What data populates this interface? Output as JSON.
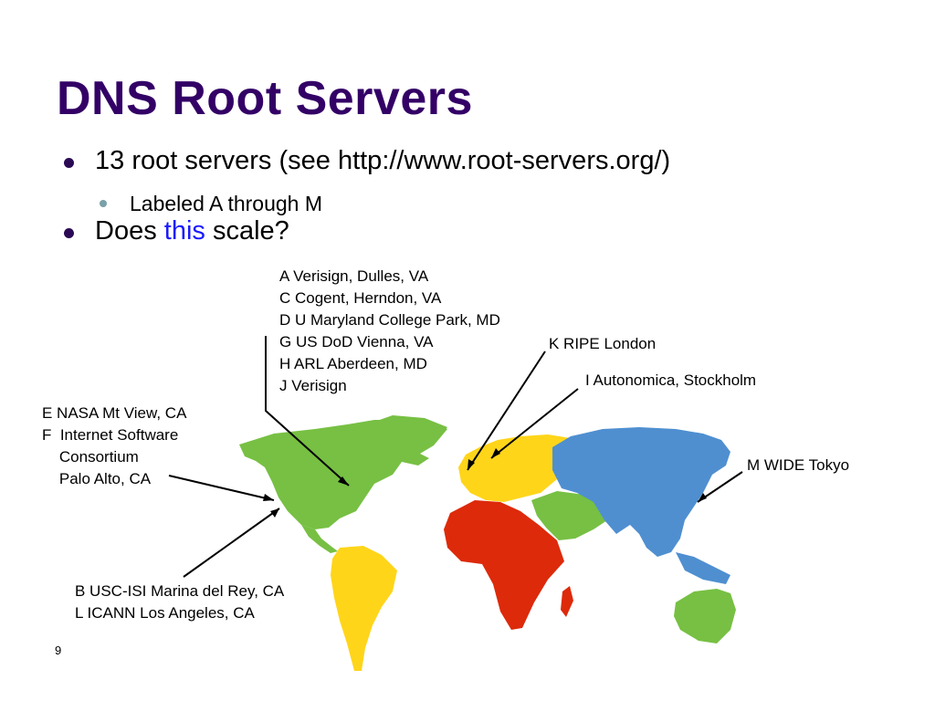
{
  "title": "DNS Root Servers",
  "bullets": {
    "b1": "13 root servers (see http://www.root-servers.org/)",
    "b1_sub": "Labeled A through M",
    "b2_pre": "Does",
    "b2_highlight": "this",
    "b2_post": "scale?"
  },
  "labels": {
    "us_east": [
      "A Verisign, Dulles, VA",
      "C Cogent, Herndon, VA",
      "D U Maryland College Park, MD",
      "G US DoD Vienna, VA",
      "H ARL Aberdeen, MD",
      "J Verisign"
    ],
    "ripe": "K RIPE London",
    "autonomica": "I Autonomica, Stockholm",
    "us_west": [
      "E NASA Mt View, CA",
      "F  Internet Software",
      "    Consortium",
      "    Palo Alto, CA"
    ],
    "wide": "M WIDE Tokyo",
    "la": [
      "B USC-ISI Marina del Rey, CA",
      "L ICANN Los Angeles, CA"
    ]
  },
  "page_number": "9",
  "colors": {
    "title": "#330066",
    "highlight": "#1a1aff",
    "north_america": "#77c043",
    "south_america": "#ffd51a",
    "europe": "#ffd51a",
    "africa": "#dd2a0a",
    "middle_east": "#77c043",
    "asia": "#4f8fd0",
    "australia": "#77c043"
  }
}
